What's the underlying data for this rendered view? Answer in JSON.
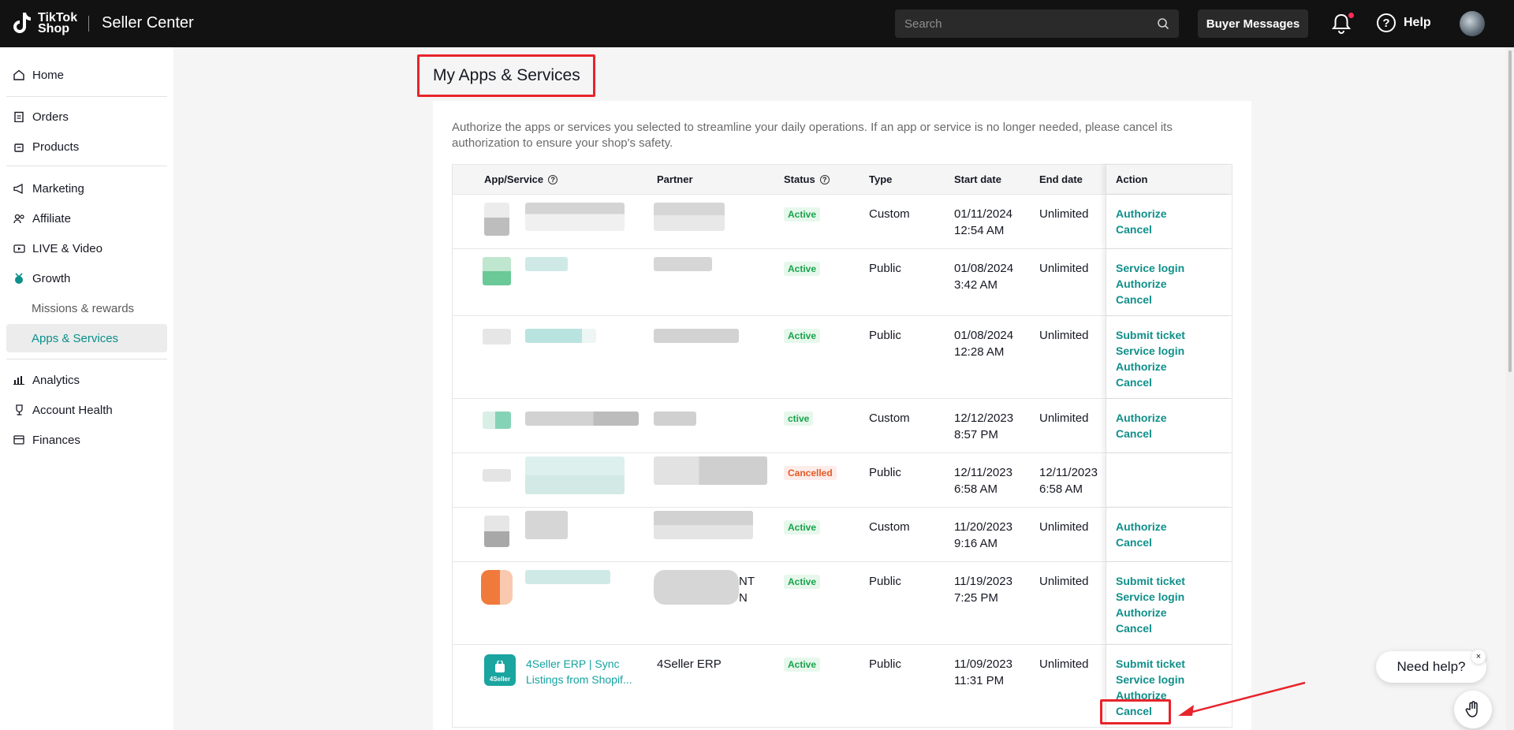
{
  "header": {
    "logo_line1": "TikTok",
    "logo_line2": "Shop",
    "title": "Seller Center",
    "search_placeholder": "Search",
    "buyer_messages": "Buyer Messages",
    "help": "Help"
  },
  "sidebar": {
    "items": [
      {
        "label": "Home",
        "icon": "home-icon"
      },
      {
        "label": "Orders",
        "icon": "clipboard-icon"
      },
      {
        "label": "Products",
        "icon": "bag-icon"
      },
      {
        "label": "Marketing",
        "icon": "megaphone-icon"
      },
      {
        "label": "Affiliate",
        "icon": "people-icon"
      },
      {
        "label": "LIVE & Video",
        "icon": "video-icon"
      },
      {
        "label": "Growth",
        "icon": "growth-icon"
      },
      {
        "label": "Missions & rewards",
        "icon": ""
      },
      {
        "label": "Apps & Services",
        "icon": ""
      },
      {
        "label": "Analytics",
        "icon": "chart-icon"
      },
      {
        "label": "Account Health",
        "icon": "trophy-icon"
      },
      {
        "label": "Finances",
        "icon": "wallet-icon"
      }
    ],
    "active_item": "Apps & Services"
  },
  "main": {
    "title": "My Apps & Services",
    "description": "Authorize the apps or services you selected to streamline your daily operations. If an app or service is no longer needed, please cancel its authorization to ensure your shop's safety.",
    "columns": {
      "app": "App/Service",
      "partner": "Partner",
      "status": "Status",
      "type": "Type",
      "start": "Start date",
      "end": "End date",
      "action": "Action"
    },
    "rows": [
      {
        "partner": "",
        "status": "Active",
        "type": "Custom",
        "start_date": "01/11/2024",
        "start_time": "12:54 AM",
        "end_date": "Unlimited",
        "end_time": "",
        "actions": [
          "Authorize",
          "Cancel"
        ]
      },
      {
        "partner": "",
        "status": "Active",
        "type": "Public",
        "start_date": "01/08/2024",
        "start_time": "3:42 AM",
        "end_date": "Unlimited",
        "end_time": "",
        "actions": [
          "Service login",
          "Authorize",
          "Cancel"
        ]
      },
      {
        "partner": "",
        "status": "Active",
        "type": "Public",
        "start_date": "01/08/2024",
        "start_time": "12:28 AM",
        "end_date": "Unlimited",
        "end_time": "",
        "actions": [
          "Submit ticket",
          "Service login",
          "Authorize",
          "Cancel"
        ]
      },
      {
        "partner": "",
        "status": "ctive",
        "type": "Custom",
        "start_date": "12/12/2023",
        "start_time": "8:57 PM",
        "end_date": "Unlimited",
        "end_time": "",
        "actions": [
          "Authorize",
          "Cancel"
        ]
      },
      {
        "partner": "",
        "status": "Cancelled",
        "type": "Public",
        "start_date": "12/11/2023",
        "start_time": "6:58 AM",
        "end_date": "12/11/2023",
        "end_time": "6:58 AM",
        "actions": []
      },
      {
        "partner": "",
        "status": "Active",
        "type": "Custom",
        "start_date": "11/20/2023",
        "start_time": "9:16 AM",
        "end_date": "Unlimited",
        "end_time": "",
        "actions": [
          "Authorize",
          "Cancel"
        ]
      },
      {
        "partner_line1": "NT",
        "partner_line2": "N",
        "status": "Active",
        "type": "Public",
        "start_date": "11/19/2023",
        "start_time": "7:25 PM",
        "end_date": "Unlimited",
        "end_time": "",
        "actions": [
          "Submit ticket",
          "Service login",
          "Authorize",
          "Cancel"
        ]
      },
      {
        "app_name": "4Seller ERP | Sync Listings from Shopif...",
        "app_icon_text": "4Seller",
        "partner": "4Seller ERP",
        "status": "Active",
        "type": "Public",
        "start_date": "11/09/2023",
        "start_time": "11:31 PM",
        "end_date": "Unlimited",
        "end_time": "",
        "actions": [
          "Submit ticket",
          "Service login",
          "Authorize",
          "Cancel"
        ]
      }
    ]
  },
  "widget": {
    "need_help": "Need help?",
    "close": "×"
  },
  "colors": {
    "accent": "#0f8f8a",
    "highlight": "#e8242b",
    "active_badge": "#16a34a",
    "cancelled_badge": "#e35a24"
  }
}
